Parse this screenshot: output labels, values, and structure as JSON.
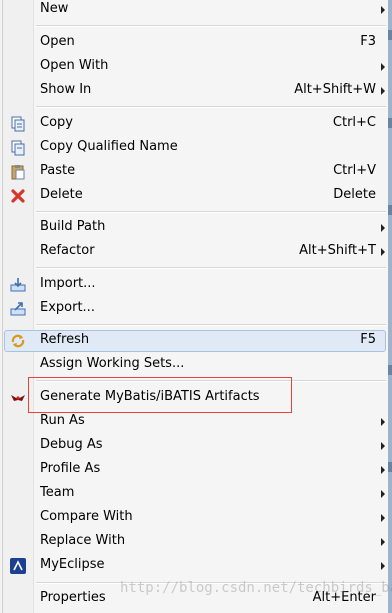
{
  "menu": {
    "new": "New",
    "open": "Open",
    "open_shortcut": "F3",
    "open_with": "Open With",
    "show_in": "Show In",
    "show_in_shortcut": "Alt+Shift+W",
    "copy": "Copy",
    "copy_shortcut": "Ctrl+C",
    "copy_qualified_name": "Copy Qualified Name",
    "paste": "Paste",
    "paste_shortcut": "Ctrl+V",
    "delete": "Delete",
    "delete_shortcut": "Delete",
    "build_path": "Build Path",
    "refactor": "Refactor",
    "refactor_shortcut": "Alt+Shift+T",
    "import": "Import...",
    "export": "Export...",
    "refresh": "Refresh",
    "refresh_shortcut": "F5",
    "assign_working_sets": "Assign Working Sets...",
    "generate_mybatis": "Generate MyBatis/iBATIS Artifacts",
    "run_as": "Run As",
    "debug_as": "Debug As",
    "profile_as": "Profile As",
    "team": "Team",
    "compare_with": "Compare With",
    "replace_with": "Replace With",
    "myeclipse": "MyEclipse",
    "properties": "Properties",
    "properties_shortcut": "Alt+Enter"
  },
  "watermark": "http://blog.csdn.net/techbirds_bao",
  "icons": {
    "copy": "copy-icon",
    "copy_qualified": "copy-qualified-name-icon",
    "paste": "paste-icon",
    "delete": "delete-icon",
    "import": "import-icon",
    "export": "export-icon",
    "refresh": "refresh-icon",
    "mybatis": "mybatis-bird-icon",
    "myeclipse": "myeclipse-icon"
  },
  "colors": {
    "highlight_bg": "#dfeaf6",
    "highlight_border": "#a9c3df",
    "annotation_red": "#e0453a",
    "delete_red": "#d9342b"
  }
}
